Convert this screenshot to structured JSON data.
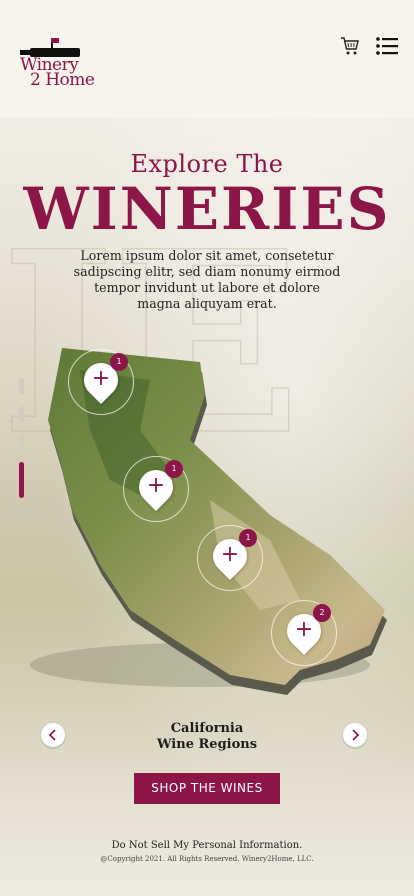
{
  "brand": {
    "line1": "Winery",
    "line2": "2 Home"
  },
  "hero": {
    "kicker": "Explore The",
    "title": "WINERIES",
    "description": "Lorem ipsum dolor sit amet, consetetur sadipscing elitr, sed diam nonumy eirmod tempor invidunt ut labore et dolore magna aliquyam erat."
  },
  "map": {
    "pins": [
      {
        "count": "1"
      },
      {
        "count": "1"
      },
      {
        "count": "1"
      },
      {
        "count": "2"
      }
    ]
  },
  "region": {
    "line1": "California",
    "line2": "Wine Regions"
  },
  "cta": {
    "label": "SHOP THE WINES"
  },
  "footer": {
    "link": "Do Not Sell My Personal Information.",
    "copyright": "@Copyright 2021. All Rights Reserved. Winery2Home, LLC."
  },
  "colors": {
    "accent": "#8c1648",
    "background": "#f4f0e6"
  },
  "icons": [
    "wine-bottle-logo-icon",
    "cart-icon",
    "menu-list-icon",
    "plus-icon",
    "chevron-left-icon",
    "chevron-right-icon"
  ]
}
